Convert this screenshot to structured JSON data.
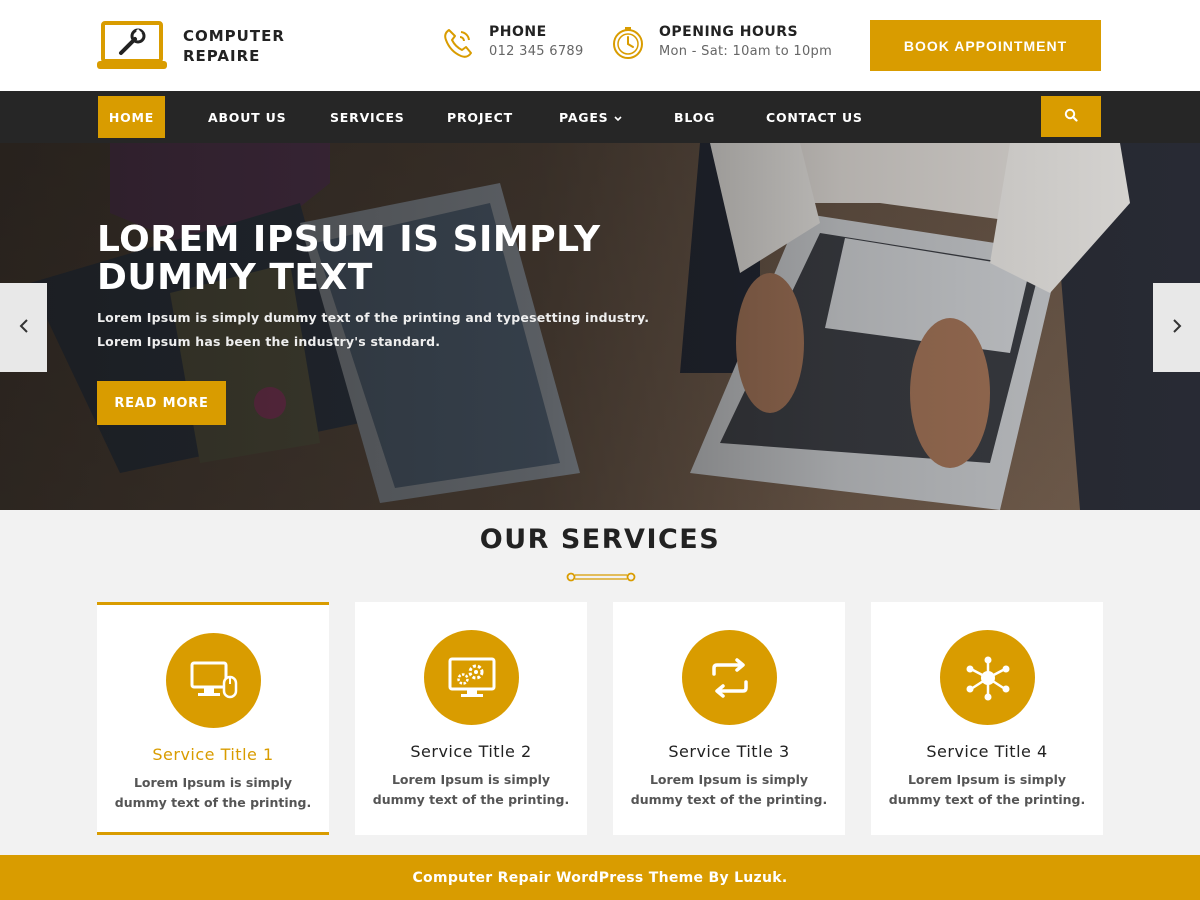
{
  "header": {
    "logo_text": "COMPUTER REPAIRE",
    "phone": {
      "title": "PHONE",
      "value": "012 345 6789",
      "icon": "phone-icon"
    },
    "hours": {
      "title": "OPENING HOURS",
      "value": "Mon - Sat: 10am to 10pm",
      "icon": "clock-icon"
    },
    "book_label": "BOOK APPOINTMENT"
  },
  "nav": {
    "items": [
      {
        "label": "HOME",
        "active": true
      },
      {
        "label": "ABOUT US"
      },
      {
        "label": "SERVICES"
      },
      {
        "label": "PROJECT"
      },
      {
        "label": "PAGES"
      },
      {
        "label": "BLOG"
      },
      {
        "label": "CONTACT US"
      }
    ],
    "search_icon": "search-icon"
  },
  "hero": {
    "title": "LOREM IPSUM IS SIMPLY DUMMY TEXT",
    "text_line1": "Lorem Ipsum is simply dummy text of the printing and typesetting industry.",
    "text_line2": "Lorem Ipsum has been the industry's standard.",
    "button": "READ MORE",
    "prev_icon": "chevron-left-icon",
    "next_icon": "chevron-right-icon"
  },
  "services": {
    "title": "OUR SERVICES",
    "cards": [
      {
        "title": "Service Title 1",
        "desc": "Lorem Ipsum is simply dummy text of the printing.",
        "icon": "desktop-mouse-icon",
        "active": true
      },
      {
        "title": "Service Title 2",
        "desc": "Lorem Ipsum is simply dummy text of the printing.",
        "icon": "monitor-gear-icon"
      },
      {
        "title": "Service Title 3",
        "desc": "Lorem Ipsum is simply dummy text of the printing.",
        "icon": "exchange-icon"
      },
      {
        "title": "Service Title 4",
        "desc": "Lorem Ipsum is simply dummy text of the printing.",
        "icon": "network-icon"
      }
    ]
  },
  "footer": {
    "text": "Computer Repair WordPress Theme By Luzuk."
  },
  "colors": {
    "accent": "#d99c00",
    "nav_bg": "#262626",
    "footer_bg": "#d99c00"
  }
}
